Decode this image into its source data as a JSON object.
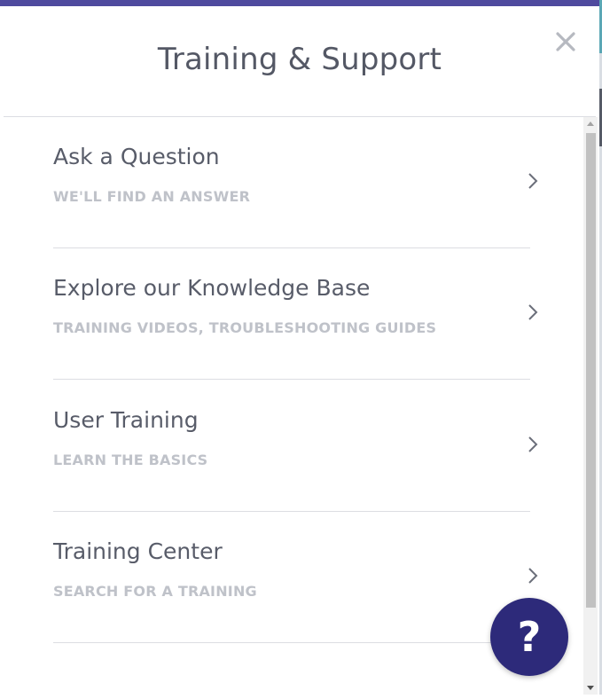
{
  "modal": {
    "title": "Training & Support",
    "close_icon": "close-icon"
  },
  "items": [
    {
      "title": "Ask a Question",
      "subtitle": "WE'LL FIND AN ANSWER",
      "icon": "chevron-right-icon"
    },
    {
      "title": "Explore our Knowledge Base",
      "subtitle": "TRAINING VIDEOS, TROUBLESHOOTING GUIDES",
      "icon": "chevron-right-icon"
    },
    {
      "title": "User Training",
      "subtitle": "LEARN THE BASICS",
      "icon": "chevron-right-icon"
    },
    {
      "title": "Training Center",
      "subtitle": "SEARCH FOR A TRAINING",
      "icon": "chevron-right-icon"
    }
  ],
  "help_button": {
    "label": "?",
    "icon": "question-mark-icon"
  },
  "colors": {
    "accent": "#4f4a9e",
    "help_button": "#2d2a7a",
    "title_text": "#545865",
    "subtitle_text": "#bfc2c9",
    "divider": "#dcdde2"
  }
}
